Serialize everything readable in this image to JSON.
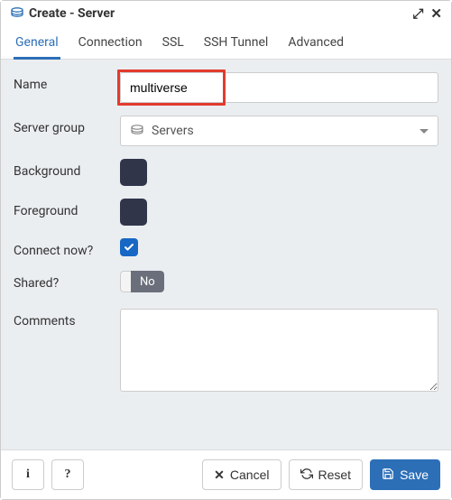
{
  "dialog": {
    "title": "Create - Server"
  },
  "tabs": [
    {
      "label": "General",
      "active": true
    },
    {
      "label": "Connection",
      "active": false
    },
    {
      "label": "SSL",
      "active": false
    },
    {
      "label": "SSH Tunnel",
      "active": false
    },
    {
      "label": "Advanced",
      "active": false
    }
  ],
  "form": {
    "name": {
      "label": "Name",
      "value": "multiverse"
    },
    "server_group": {
      "label": "Server group",
      "selected": "Servers"
    },
    "background": {
      "label": "Background",
      "color": "#31354a"
    },
    "foreground": {
      "label": "Foreground",
      "color": "#31354a"
    },
    "connect_now": {
      "label": "Connect now?",
      "checked": true
    },
    "shared": {
      "label": "Shared?",
      "value_label": "No"
    },
    "comments": {
      "label": "Comments",
      "value": ""
    }
  },
  "footer": {
    "info_glyph": "i",
    "help_glyph": "?",
    "cancel": "Cancel",
    "reset": "Reset",
    "save": "Save"
  }
}
